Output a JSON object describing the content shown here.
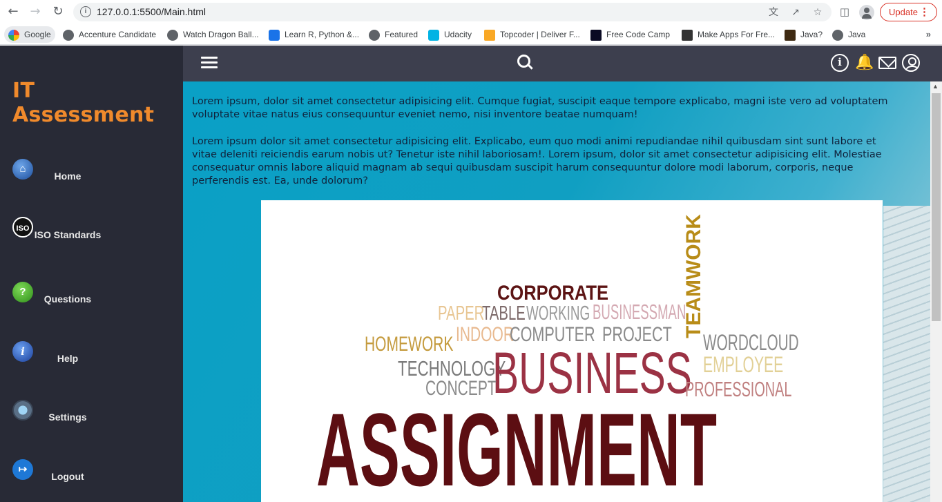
{
  "browser": {
    "url": "127.0.0.1:5500/Main.html",
    "update_label": "Update",
    "bookmarks": [
      "Google",
      "Accenture Candidate",
      "Watch Dragon Ball...",
      "Learn R, Python &...",
      "Featured",
      "Udacity",
      "Topcoder | Deliver F...",
      "Free Code Camp",
      "Make Apps For Fre...",
      "Java?",
      "Java"
    ]
  },
  "sidebar": {
    "title": "IT Assessment",
    "items": [
      {
        "label": "Home",
        "icon": "home-icon"
      },
      {
        "label": "ISO Standards",
        "icon": "iso-icon"
      },
      {
        "label": "Questions",
        "icon": "question-icon"
      },
      {
        "label": "Help",
        "icon": "info-icon"
      },
      {
        "label": "Settings",
        "icon": "settings-icon"
      },
      {
        "label": "Logout",
        "icon": "logout-icon"
      }
    ]
  },
  "content": {
    "paragraph1": "Lorem ipsum, dolor sit amet consectetur adipisicing elit. Cumque fugiat, suscipit eaque tempore explicabo, magni iste vero ad voluptatem voluptate vitae natus eius consequuntur eveniet nemo, nisi inventore beatae numquam!",
    "paragraph2": "Lorem ipsum dolor sit amet consectetur adipisicing elit. Explicabo, eum quo modi animi repudiandae nihil quibusdam sint sunt labore et vitae deleniti reiciendis earum nobis ut? Tenetur iste nihil laboriosam!. Lorem ipsum, dolor sit amet consectetur adipisicing elit. Molestiae consequatur omnis labore aliquid magnam ab sequi quibusdam suscipit harum consequuntur dolore modi laborum, corporis, neque perferendis est. Ea, unde dolorum?",
    "word_cloud": {
      "corporate": "CORPORATE",
      "teamwork": "TEAMWORK",
      "paper": "PAPER",
      "table": "TABLE",
      "working": "WORKING",
      "businessman": "BUSINESSMAN",
      "homework": "HOMEWORK",
      "indoor": "INDOOR",
      "computer": "COMPUTER",
      "project": "PROJECT",
      "wordcloud": "WORDCLOUD",
      "technology": "TECHNOLOGY",
      "business": "BUSINESS",
      "employee": "EMPLOYEE",
      "concept": "CONCEPT",
      "professional": "PROFESSIONAL",
      "assignment": "ASSIGNMENT"
    }
  }
}
